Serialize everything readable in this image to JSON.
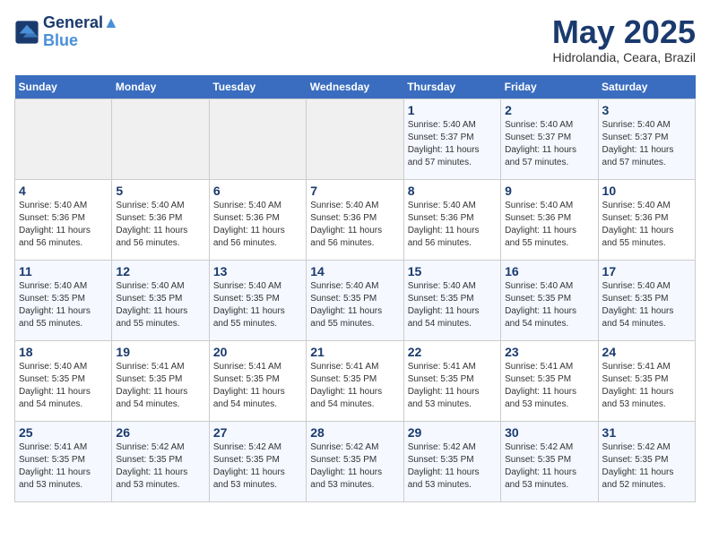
{
  "logo": {
    "line1": "General",
    "line2": "Blue"
  },
  "title": "May 2025",
  "subtitle": "Hidrolandia, Ceara, Brazil",
  "weekdays": [
    "Sunday",
    "Monday",
    "Tuesday",
    "Wednesday",
    "Thursday",
    "Friday",
    "Saturday"
  ],
  "weeks": [
    [
      {
        "day": "",
        "info": ""
      },
      {
        "day": "",
        "info": ""
      },
      {
        "day": "",
        "info": ""
      },
      {
        "day": "",
        "info": ""
      },
      {
        "day": "1",
        "info": "Sunrise: 5:40 AM\nSunset: 5:37 PM\nDaylight: 11 hours\nand 57 minutes."
      },
      {
        "day": "2",
        "info": "Sunrise: 5:40 AM\nSunset: 5:37 PM\nDaylight: 11 hours\nand 57 minutes."
      },
      {
        "day": "3",
        "info": "Sunrise: 5:40 AM\nSunset: 5:37 PM\nDaylight: 11 hours\nand 57 minutes."
      }
    ],
    [
      {
        "day": "4",
        "info": "Sunrise: 5:40 AM\nSunset: 5:36 PM\nDaylight: 11 hours\nand 56 minutes."
      },
      {
        "day": "5",
        "info": "Sunrise: 5:40 AM\nSunset: 5:36 PM\nDaylight: 11 hours\nand 56 minutes."
      },
      {
        "day": "6",
        "info": "Sunrise: 5:40 AM\nSunset: 5:36 PM\nDaylight: 11 hours\nand 56 minutes."
      },
      {
        "day": "7",
        "info": "Sunrise: 5:40 AM\nSunset: 5:36 PM\nDaylight: 11 hours\nand 56 minutes."
      },
      {
        "day": "8",
        "info": "Sunrise: 5:40 AM\nSunset: 5:36 PM\nDaylight: 11 hours\nand 56 minutes."
      },
      {
        "day": "9",
        "info": "Sunrise: 5:40 AM\nSunset: 5:36 PM\nDaylight: 11 hours\nand 55 minutes."
      },
      {
        "day": "10",
        "info": "Sunrise: 5:40 AM\nSunset: 5:36 PM\nDaylight: 11 hours\nand 55 minutes."
      }
    ],
    [
      {
        "day": "11",
        "info": "Sunrise: 5:40 AM\nSunset: 5:35 PM\nDaylight: 11 hours\nand 55 minutes."
      },
      {
        "day": "12",
        "info": "Sunrise: 5:40 AM\nSunset: 5:35 PM\nDaylight: 11 hours\nand 55 minutes."
      },
      {
        "day": "13",
        "info": "Sunrise: 5:40 AM\nSunset: 5:35 PM\nDaylight: 11 hours\nand 55 minutes."
      },
      {
        "day": "14",
        "info": "Sunrise: 5:40 AM\nSunset: 5:35 PM\nDaylight: 11 hours\nand 55 minutes."
      },
      {
        "day": "15",
        "info": "Sunrise: 5:40 AM\nSunset: 5:35 PM\nDaylight: 11 hours\nand 54 minutes."
      },
      {
        "day": "16",
        "info": "Sunrise: 5:40 AM\nSunset: 5:35 PM\nDaylight: 11 hours\nand 54 minutes."
      },
      {
        "day": "17",
        "info": "Sunrise: 5:40 AM\nSunset: 5:35 PM\nDaylight: 11 hours\nand 54 minutes."
      }
    ],
    [
      {
        "day": "18",
        "info": "Sunrise: 5:40 AM\nSunset: 5:35 PM\nDaylight: 11 hours\nand 54 minutes."
      },
      {
        "day": "19",
        "info": "Sunrise: 5:41 AM\nSunset: 5:35 PM\nDaylight: 11 hours\nand 54 minutes."
      },
      {
        "day": "20",
        "info": "Sunrise: 5:41 AM\nSunset: 5:35 PM\nDaylight: 11 hours\nand 54 minutes."
      },
      {
        "day": "21",
        "info": "Sunrise: 5:41 AM\nSunset: 5:35 PM\nDaylight: 11 hours\nand 54 minutes."
      },
      {
        "day": "22",
        "info": "Sunrise: 5:41 AM\nSunset: 5:35 PM\nDaylight: 11 hours\nand 53 minutes."
      },
      {
        "day": "23",
        "info": "Sunrise: 5:41 AM\nSunset: 5:35 PM\nDaylight: 11 hours\nand 53 minutes."
      },
      {
        "day": "24",
        "info": "Sunrise: 5:41 AM\nSunset: 5:35 PM\nDaylight: 11 hours\nand 53 minutes."
      }
    ],
    [
      {
        "day": "25",
        "info": "Sunrise: 5:41 AM\nSunset: 5:35 PM\nDaylight: 11 hours\nand 53 minutes."
      },
      {
        "day": "26",
        "info": "Sunrise: 5:42 AM\nSunset: 5:35 PM\nDaylight: 11 hours\nand 53 minutes."
      },
      {
        "day": "27",
        "info": "Sunrise: 5:42 AM\nSunset: 5:35 PM\nDaylight: 11 hours\nand 53 minutes."
      },
      {
        "day": "28",
        "info": "Sunrise: 5:42 AM\nSunset: 5:35 PM\nDaylight: 11 hours\nand 53 minutes."
      },
      {
        "day": "29",
        "info": "Sunrise: 5:42 AM\nSunset: 5:35 PM\nDaylight: 11 hours\nand 53 minutes."
      },
      {
        "day": "30",
        "info": "Sunrise: 5:42 AM\nSunset: 5:35 PM\nDaylight: 11 hours\nand 53 minutes."
      },
      {
        "day": "31",
        "info": "Sunrise: 5:42 AM\nSunset: 5:35 PM\nDaylight: 11 hours\nand 52 minutes."
      }
    ]
  ]
}
